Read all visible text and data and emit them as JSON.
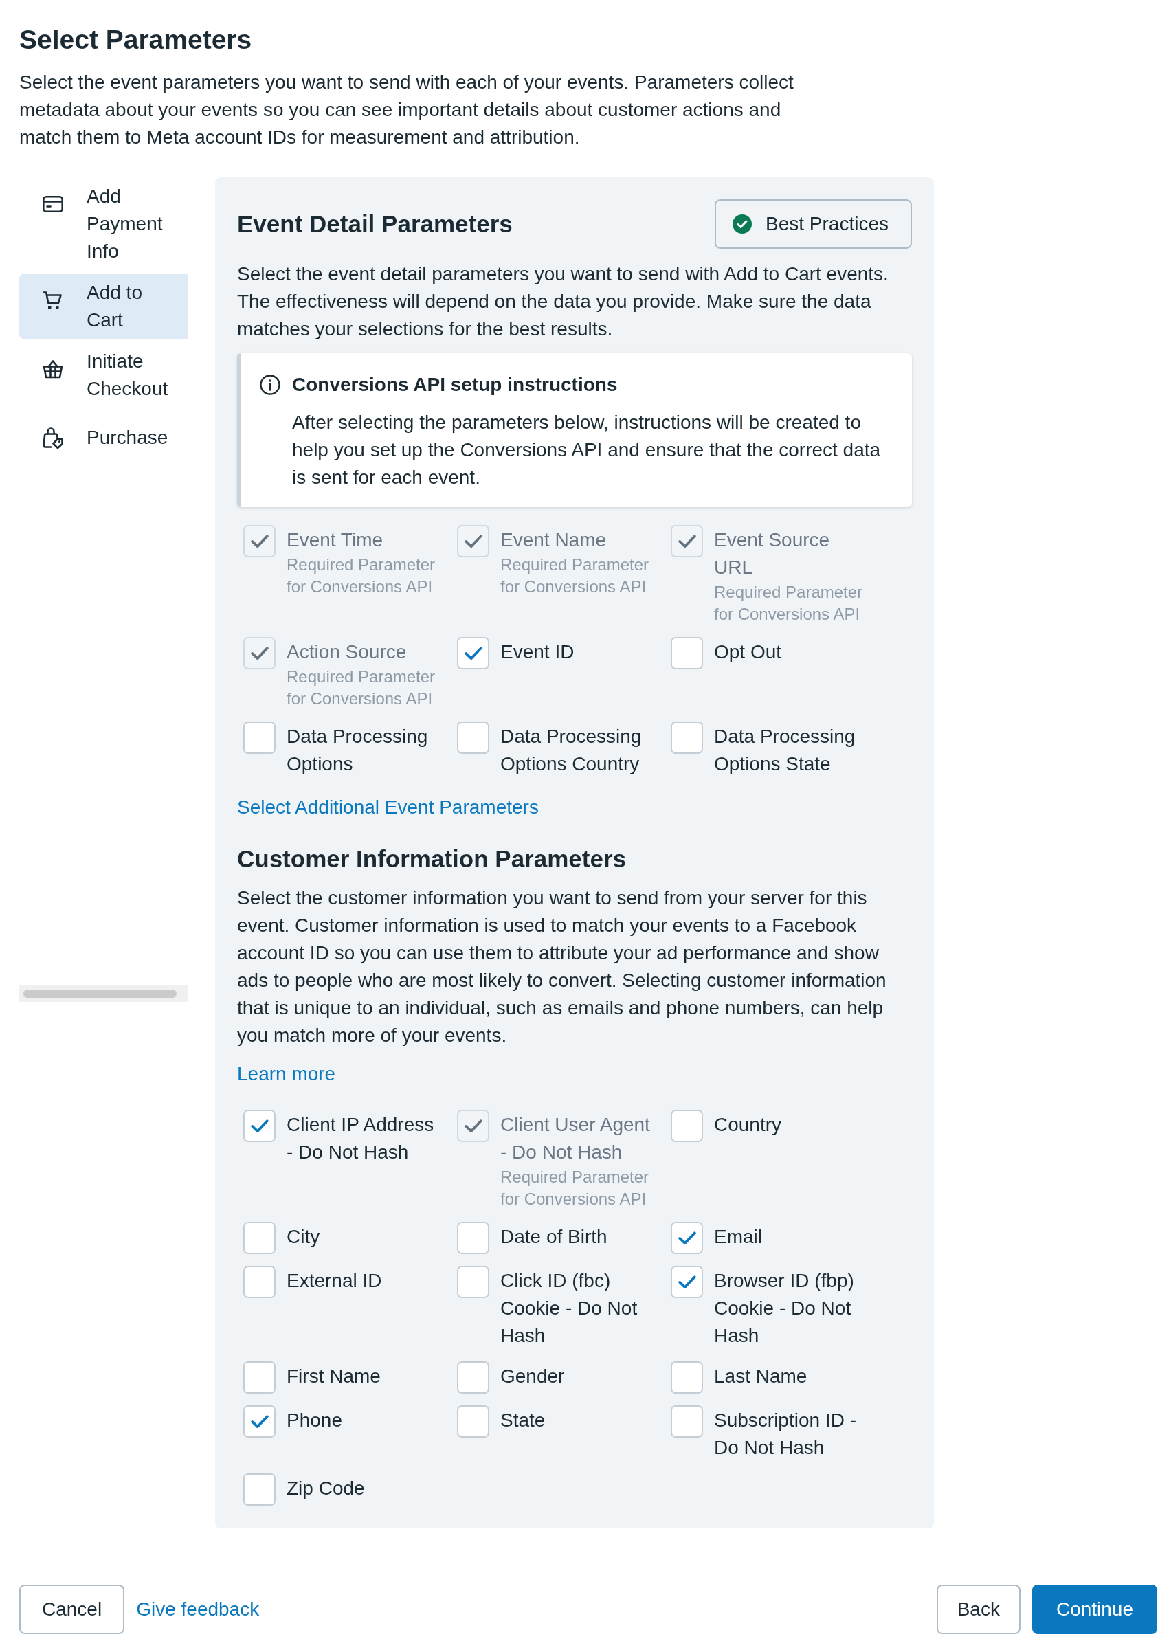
{
  "title": "Select Parameters",
  "description": "Select the event parameters you want to send with each of your events. Parameters collect metadata about your events so you can see important details about customer actions and match them to Meta account IDs for measurement and attribution.",
  "sidebar": {
    "items": [
      {
        "label": "Add Payment Info",
        "selected": false
      },
      {
        "label": "Add to Cart",
        "selected": true
      },
      {
        "label": "Initiate Checkout",
        "selected": false
      },
      {
        "label": "Purchase",
        "selected": false
      }
    ]
  },
  "panel": {
    "event_details": {
      "heading": "Event Detail Parameters",
      "best_practices_button": "Best Practices",
      "description": "Select the event detail parameters you want to send with Add to Cart events. The effectiveness will depend on the data you provide. Make sure the data matches your selections for the best results.",
      "notice": {
        "title": "Conversions API setup instructions",
        "body": "After selecting the parameters below, instructions will be created to help you set up the Conversions API and ensure that the correct data is sent for each event."
      },
      "parameters": [
        {
          "label": "Event Time",
          "note": "Required Parameter for Conversions API",
          "checked": true,
          "disabled": true
        },
        {
          "label": "Event Name",
          "note": "Required Parameter for Conversions API",
          "checked": true,
          "disabled": true
        },
        {
          "label": "Event Source URL",
          "note": "Required Parameter for Conversions API",
          "checked": true,
          "disabled": true
        },
        {
          "label": "Action Source",
          "note": "Required Parameter for Conversions API",
          "checked": true,
          "disabled": true
        },
        {
          "label": "Event ID",
          "checked": true,
          "disabled": false
        },
        {
          "label": "Opt Out",
          "checked": false,
          "disabled": false
        },
        {
          "label": "Data Processing Options",
          "checked": false,
          "disabled": false
        },
        {
          "label": "Data Processing Options Country",
          "checked": false,
          "disabled": false
        },
        {
          "label": "Data Processing Options State",
          "checked": false,
          "disabled": false
        }
      ],
      "link": "Select Additional Event Parameters"
    },
    "customer_information": {
      "heading": "Customer Information Parameters",
      "description": "Select the customer information you want to send from your server for this event. Customer information is used to match your events to a Facebook account ID so you can use them to attribute your ad performance and show ads to people who are most likely to convert. Selecting customer information that is unique to an individual, such as emails and phone numbers, can help you match more of your events.",
      "link": "Learn more",
      "parameters": [
        {
          "label": "Client IP Address - Do Not Hash",
          "checked": true,
          "disabled": false
        },
        {
          "label": "Client User Agent - Do Not Hash",
          "note": "Required Parameter for Conversions API",
          "checked": true,
          "disabled": true
        },
        {
          "label": "Country",
          "checked": false,
          "disabled": false
        },
        {
          "label": "City",
          "checked": false,
          "disabled": false
        },
        {
          "label": "Date of Birth",
          "checked": false,
          "disabled": false
        },
        {
          "label": "Email",
          "checked": true,
          "disabled": false
        },
        {
          "label": "External ID",
          "checked": false,
          "disabled": false
        },
        {
          "label": "Click ID (fbc) Cookie - Do Not Hash",
          "checked": false,
          "disabled": false
        },
        {
          "label": "Browser ID (fbp) Cookie - Do Not Hash",
          "checked": true,
          "disabled": false
        },
        {
          "label": "First Name",
          "checked": false,
          "disabled": false
        },
        {
          "label": "Gender",
          "checked": false,
          "disabled": false
        },
        {
          "label": "Last Name",
          "checked": false,
          "disabled": false
        },
        {
          "label": "Phone",
          "checked": true,
          "disabled": false
        },
        {
          "label": "State",
          "checked": false,
          "disabled": false
        },
        {
          "label": "Subscription ID - Do Not Hash",
          "checked": false,
          "disabled": false
        },
        {
          "label": "Zip Code",
          "checked": false,
          "disabled": false
        }
      ]
    }
  },
  "footer": {
    "cancel_button": "Cancel",
    "feedback_link": "Give feedback",
    "back_button": "Back",
    "continue_button": "Continue"
  }
}
